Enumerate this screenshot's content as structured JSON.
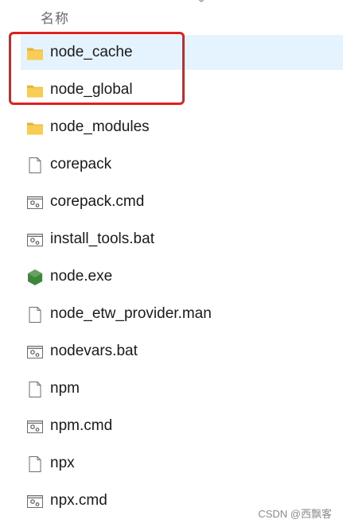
{
  "header": {
    "name_column": "名称"
  },
  "files": [
    {
      "name": "node_cache",
      "icon": "folder-icon",
      "selected": true
    },
    {
      "name": "node_global",
      "icon": "folder-icon",
      "selected": false
    },
    {
      "name": "node_modules",
      "icon": "folder-icon",
      "selected": false
    },
    {
      "name": "corepack",
      "icon": "file-icon",
      "selected": false
    },
    {
      "name": "corepack.cmd",
      "icon": "batch-file-icon",
      "selected": false
    },
    {
      "name": "install_tools.bat",
      "icon": "batch-file-icon",
      "selected": false
    },
    {
      "name": "node.exe",
      "icon": "node-exe-icon",
      "selected": false
    },
    {
      "name": "node_etw_provider.man",
      "icon": "file-icon",
      "selected": false
    },
    {
      "name": "nodevars.bat",
      "icon": "batch-file-icon",
      "selected": false
    },
    {
      "name": "npm",
      "icon": "file-icon",
      "selected": false
    },
    {
      "name": "npm.cmd",
      "icon": "batch-file-icon",
      "selected": false
    },
    {
      "name": "npx",
      "icon": "file-icon",
      "selected": false
    },
    {
      "name": "npx.cmd",
      "icon": "batch-file-icon",
      "selected": false
    }
  ],
  "colors": {
    "highlight": "#e0201c",
    "selection": "#e5f3ff",
    "folder": "#f5c84c",
    "node_green": "#3c873a"
  },
  "watermark": "CSDN @西飘客"
}
